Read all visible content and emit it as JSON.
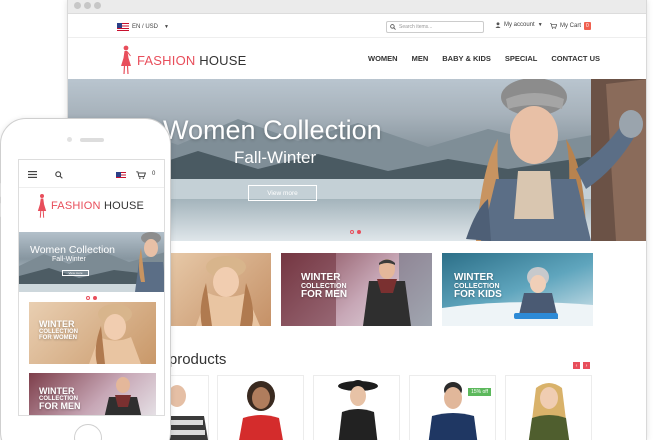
{
  "desktop": {
    "topbar": {
      "language": "EN / USD",
      "search_placeholder": "Search items...",
      "account_label": "My account",
      "cart_label": "My Cart",
      "cart_count": "0"
    },
    "logo": {
      "part1": "FASHION ",
      "part2": "HOUSE"
    },
    "nav": [
      "WOMEN",
      "MEN",
      "BABY & KIDS",
      "SPECIAL",
      "CONTACT US"
    ],
    "hero": {
      "title": "Women Collection",
      "subtitle": "Fall-Winter",
      "button": "View more"
    },
    "promos": [
      {
        "big": "",
        "small": ""
      },
      {
        "big": "WINTER",
        "small": "COLLECTION",
        "big2": "FOR MEN"
      },
      {
        "big": "WINTER",
        "small": "COLLECTION",
        "big2": "FOR KIDS"
      }
    ],
    "section_title": "ed products",
    "arrows": {
      "prev": "‹",
      "next": "›"
    },
    "sale_badge": "15% off"
  },
  "mobile": {
    "cart_count": "0",
    "logo": {
      "part1": "FASHION ",
      "part2": "HOUSE"
    },
    "hero": {
      "title": "Women Collection",
      "subtitle": "Fall-Winter",
      "button": "View more"
    },
    "promos": [
      {
        "big": "WINTER",
        "small": "COLLECTION",
        "big2": "FOR WOMEN"
      },
      {
        "big": "WINTER",
        "small": "COLLECTION",
        "big2": "FOR MEN"
      }
    ]
  },
  "colors": {
    "accent": "#e84e5b",
    "sale": "#5cb85c",
    "text": "#333333"
  }
}
